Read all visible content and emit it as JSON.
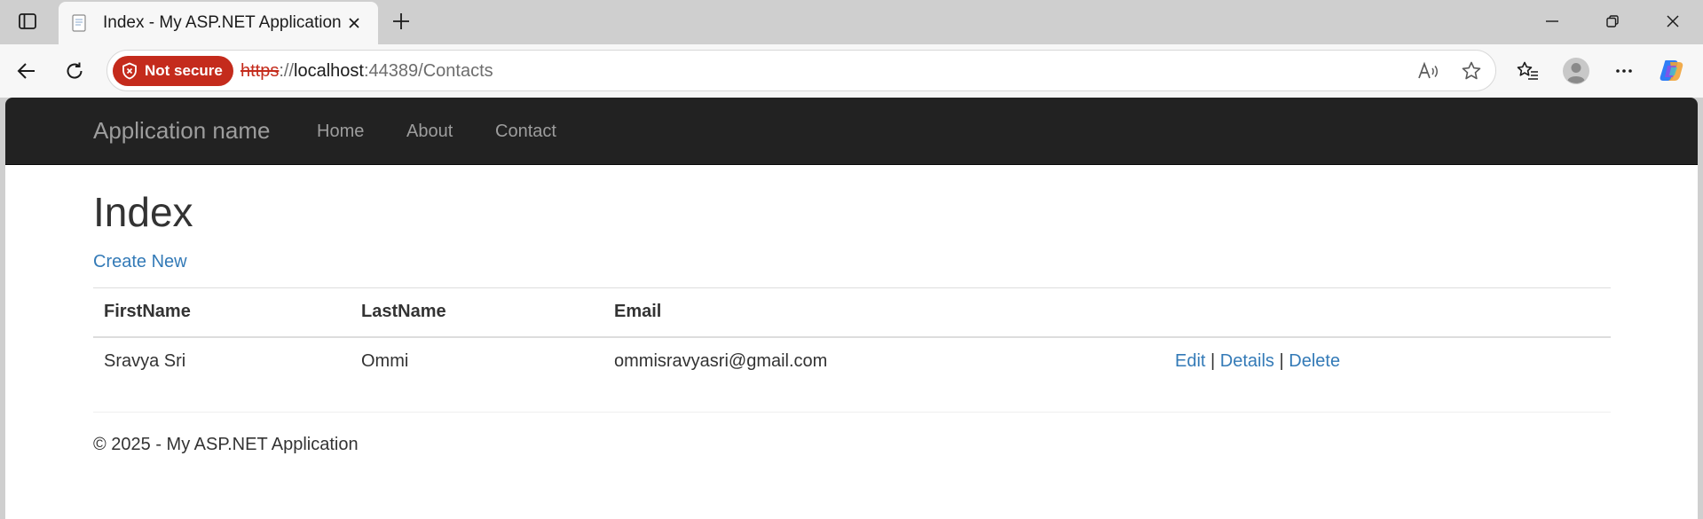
{
  "browser": {
    "tab_title": "Index - My ASP.NET Application",
    "security_label": "Not secure",
    "url_scheme": "https",
    "url_sep": "://",
    "url_host": "localhost",
    "url_port": ":44389",
    "url_path": "/Contacts"
  },
  "navbar": {
    "brand": "Application name",
    "links": [
      "Home",
      "About",
      "Contact"
    ]
  },
  "page": {
    "heading": "Index",
    "create_link": "Create New",
    "table": {
      "headers": [
        "FirstName",
        "LastName",
        "Email"
      ],
      "rows": [
        {
          "first_name": "Sravya Sri",
          "last_name": "Ommi",
          "email": "ommisravyasri@gmail.com",
          "actions": [
            "Edit",
            "Details",
            "Delete"
          ],
          "separator": "|"
        }
      ]
    },
    "footer": "© 2025 - My ASP.NET Application"
  },
  "colors": {
    "navbar_bg": "#222222",
    "link": "#337ab7",
    "not_secure_badge": "#c42b1c",
    "nav_text": "#9d9d9d"
  }
}
